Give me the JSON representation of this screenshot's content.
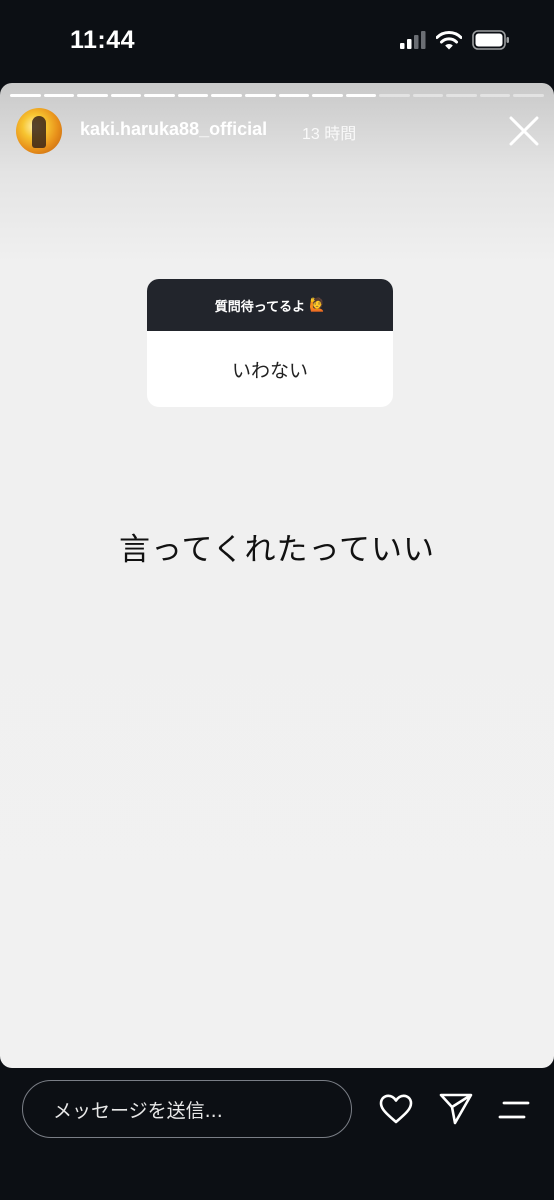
{
  "status_bar": {
    "time": "11:44"
  },
  "story": {
    "username": "kaki.haruka88_official",
    "time_ago": "13 時間",
    "progress": {
      "total_segments": 16,
      "completed_segments": 11
    },
    "question_sticker": {
      "header": "質問待ってるよ",
      "header_emoji": "🙋",
      "answer": "いわない"
    },
    "main_text": "言ってくれたっていい"
  },
  "reply_bar": {
    "message_placeholder": "メッセージを送信..."
  },
  "colors": {
    "background": "#0c0f14",
    "story_background": "#f1f1f1",
    "sticker_header": "#22252c"
  },
  "icons": [
    "signal-icon",
    "wifi-icon",
    "battery-icon",
    "close-icon",
    "heart-icon",
    "send-icon",
    "more-icon"
  ]
}
